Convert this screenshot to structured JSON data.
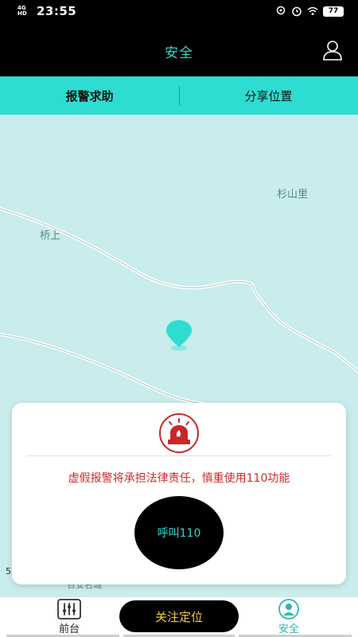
{
  "status_bar": {
    "network": "4G HD",
    "time": "23:55",
    "battery": "77"
  },
  "header": {
    "title": "安全"
  },
  "tabs": [
    {
      "label": "报警求助",
      "active": true
    },
    {
      "label": "分享位置",
      "active": false
    }
  ],
  "map": {
    "places": [
      "杉山里",
      "桥上"
    ],
    "scale_fragment": "5",
    "bottom_label": "百安名城"
  },
  "dialog": {
    "warning": "虚假报警将承担法律责任，慎重使用110功能",
    "call_label": "呼叫110"
  },
  "bottom_nav": {
    "front_label": "前台",
    "follow_label": "关注定位",
    "safety_label": "安全"
  },
  "colors": {
    "accent": "#2dddd2",
    "warning": "#d42a2a",
    "follow_text": "#f3cf3b",
    "map_bg": "#c9ecec"
  }
}
